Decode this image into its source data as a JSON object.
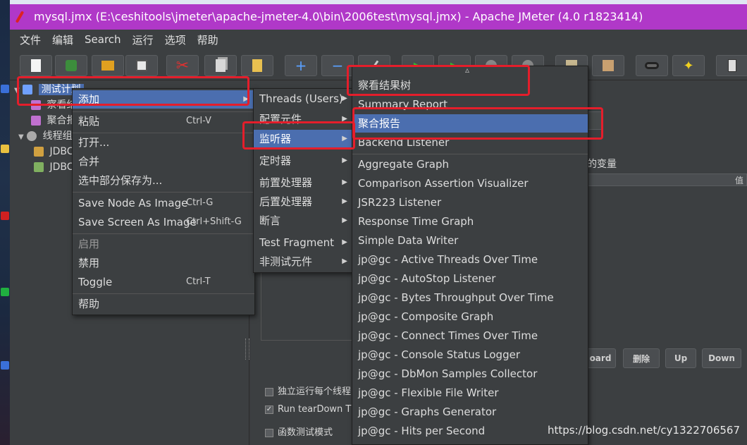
{
  "window": {
    "title": "mysql.jmx (E:\\ceshitools\\jmeter\\apache-jmeter-4.0\\bin\\2006test\\mysql.jmx) - Apache JMeter (4.0 r1823414)"
  },
  "menubar": {
    "items": [
      "文件",
      "编辑",
      "Search",
      "运行",
      "选项",
      "帮助"
    ]
  },
  "toolbar": {
    "icons": [
      "new-icon",
      "templates-icon",
      "open-icon",
      "save-icon",
      "cut-icon",
      "copy-icon",
      "paste-icon",
      "expand-icon",
      "collapse-icon",
      "toggle-icon",
      "start-icon",
      "start-no-pause-icon",
      "stop-icon",
      "shutdown-icon",
      "clear-icon",
      "clear-all-icon",
      "search-icon",
      "reset-search-icon",
      "function-helper-icon"
    ],
    "expand_glyph": "+",
    "collapse_glyph": "−"
  },
  "tree": {
    "test_plan": "测试计划",
    "view_results_partial": "察看结",
    "aggregate_partial": "聚合报",
    "thread_group_partial": "线程组",
    "jdbc1_partial": "JDBC",
    "jdbc2_partial": "JDBC"
  },
  "context_menu": {
    "add": "添加",
    "paste": "粘贴",
    "paste_accel": "Ctrl-V",
    "open": "打开...",
    "merge": "合并",
    "save_selection": "选中部分保存为...",
    "save_node_image": "Save Node As Image",
    "save_node_image_accel": "Ctrl-G",
    "save_screen_image": "Save Screen As Image",
    "save_screen_image_accel": "Ctrl+Shift-G",
    "enable": "启用",
    "disable": "禁用",
    "toggle": "Toggle",
    "toggle_accel": "Ctrl-T",
    "help": "帮助"
  },
  "add_submenu": {
    "items": [
      "Threads (Users)",
      "配置元件",
      "监听器",
      "定时器",
      "前置处理器",
      "后置处理器",
      "断言",
      "Test Fragment",
      "非测试元件"
    ]
  },
  "listener_submenu": {
    "items": [
      "察看结果树",
      "Summary Report",
      "聚合报告",
      "Backend Listener",
      "Aggregate Graph",
      "Comparison Assertion Visualizer",
      "JSR223 Listener",
      "Response Time Graph",
      "Simple Data Writer",
      "jp@gc - Active Threads Over Time",
      "jp@gc - AutoStop Listener",
      "jp@gc - Bytes Throughput Over Time",
      "jp@gc - Composite Graph",
      "jp@gc - Connect Times Over Time",
      "jp@gc - Console Status Logger",
      "jp@gc - DbMon Samples Collector",
      "jp@gc - Flexible File Writer",
      "jp@gc - Graphs Generator",
      "jp@gc - Hits per Second"
    ],
    "scroll_up_glyph": "▵"
  },
  "right_panel": {
    "variables_label": "的变量",
    "table_header_cut": "值",
    "buttons": [
      "oard",
      "删除",
      "Up",
      "Down"
    ],
    "checkboxes": [
      {
        "label": "独立运行每个线程",
        "checked": false
      },
      {
        "label": "Run tearDown Thr",
        "checked": true
      },
      {
        "label": "函数测试模式",
        "checked": false
      }
    ]
  },
  "watermark": "https://blog.csdn.net/cy1322706567",
  "colors": {
    "titlebar": "#b038c8",
    "highlight": "#4b6eaf",
    "annotation_red": "#e41e2b",
    "panel": "#3c3f41"
  }
}
